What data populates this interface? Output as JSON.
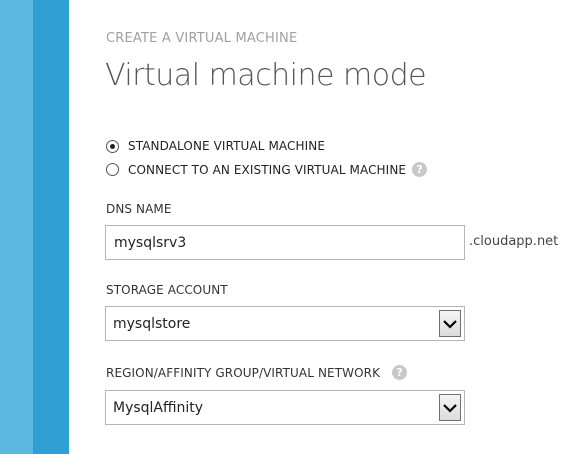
{
  "breadcrumb": "CREATE A VIRTUAL MACHINE",
  "title": "Virtual machine mode",
  "mode_options": [
    {
      "label": "STANDALONE VIRTUAL MACHINE",
      "checked": true
    },
    {
      "label": "CONNECT TO AN EXISTING VIRTUAL MACHINE",
      "checked": false
    }
  ],
  "help_glyph": "?",
  "dns": {
    "label": "DNS NAME",
    "value": "mysqlsrv3",
    "suffix": ".cloudapp.net"
  },
  "storage": {
    "label": "STORAGE ACCOUNT",
    "value": "mysqlstore"
  },
  "region": {
    "label": "REGION/AFFINITY GROUP/VIRTUAL NETWORK",
    "value": "MysqlAffinity"
  },
  "colors": {
    "stripe_outer": "#5cb8e1",
    "stripe_inner": "#2f9fd4"
  },
  "icons": {
    "help": "question-circle-icon",
    "dropdown": "chevron-down-icon"
  }
}
